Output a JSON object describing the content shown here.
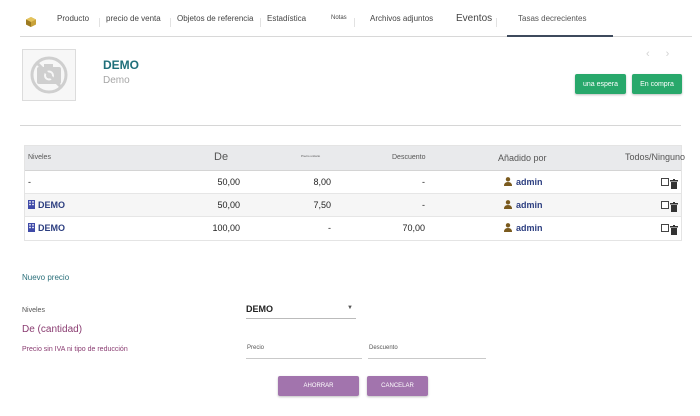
{
  "tabs": [
    {
      "label": "Producto"
    },
    {
      "label": "precio de venta"
    },
    {
      "label": "Objetos de referencia"
    },
    {
      "label": "Estadística"
    },
    {
      "label": "Notas"
    },
    {
      "label": "Archivos adjuntos"
    },
    {
      "label": "Eventos"
    },
    {
      "label": "Tasas decrecientes"
    }
  ],
  "active_tab": "Tasas decrecientes",
  "product": {
    "ref": "DEMO",
    "label": "Demo",
    "status_buttons": {
      "wait": "una espera",
      "buy": "En compra"
    }
  },
  "nav": {
    "prev": "‹",
    "next": "›"
  },
  "table": {
    "headers": {
      "levels": "Niveles",
      "from": "De",
      "price": "Precio unitario",
      "discount": "Descuento",
      "added_by": "Añadido por",
      "all_none": "Todos/Ninguno"
    },
    "rows": [
      {
        "level": "-",
        "from": "50,00",
        "price": "8,00",
        "discount": "-",
        "user": "admin",
        "has_level_icon": false
      },
      {
        "level": "DEMO",
        "from": "50,00",
        "price": "7,50",
        "discount": "-",
        "user": "admin",
        "has_level_icon": true
      },
      {
        "level": "DEMO",
        "from": "100,00",
        "price": "-",
        "discount": "70,00",
        "user": "admin",
        "has_level_icon": true
      }
    ]
  },
  "form": {
    "title": "Nuevo precio",
    "levels_label": "Niveles",
    "levels_value": "DEMO",
    "qty_label": "De (cantidad)",
    "price_no_tax_label": "Precio sin IVA ni tipo de reducción",
    "price_placeholder": "Precio",
    "discount_placeholder": "Descuento",
    "save_label": "AHORRAR",
    "cancel_label": "CANCELAR"
  },
  "colors": {
    "accent_green": "#28a86b",
    "accent_purple": "#a274ad",
    "link_blue": "#2c3e80",
    "title_teal": "#1f6f7a"
  }
}
